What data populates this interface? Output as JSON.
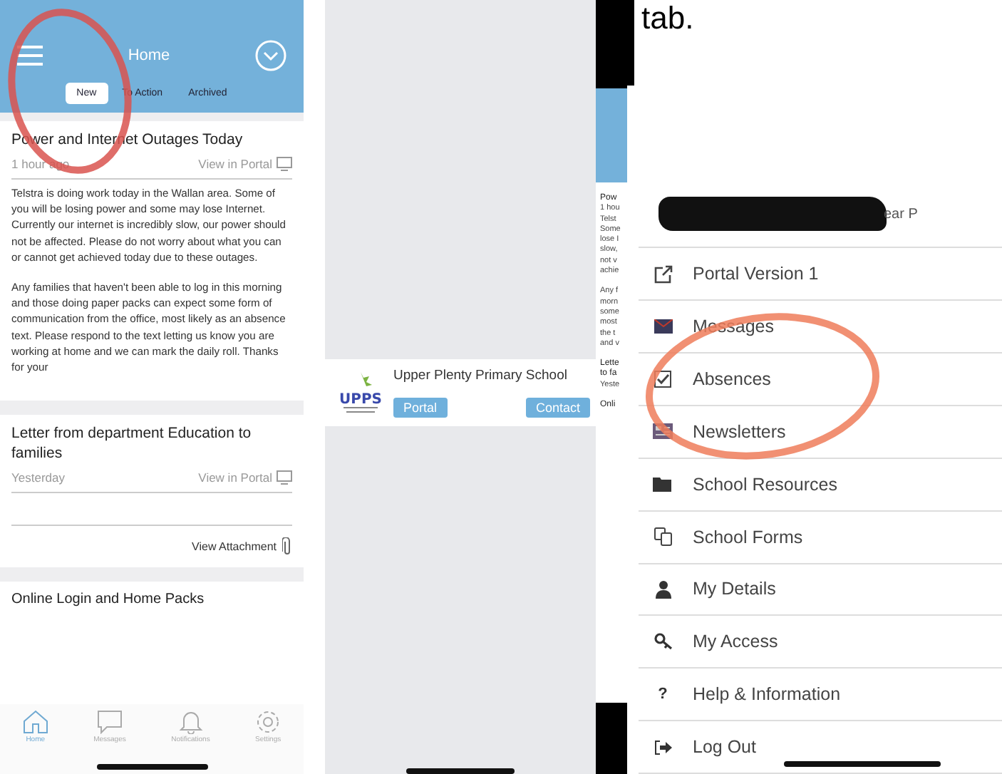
{
  "home_screen": {
    "title": "Home",
    "tabs": [
      {
        "label": "New",
        "selected": true
      },
      {
        "label": "To Action",
        "selected": false
      },
      {
        "label": "Archived",
        "selected": false
      }
    ],
    "posts": [
      {
        "title": "Power and Internet Outages Today",
        "time": "1 hour ago",
        "link": "View in Portal",
        "paragraphs": [
          "Telstra is doing work today in the Wallan area. Some of you will be losing power and some may lose Internet. Currently our internet is incredibly slow, our power should not be affected. Please do not worry about what you can or cannot get achieved today due to these outages.",
          "Any families that haven't been able to log in this morning and those doing paper packs can expect some form of communication from the office, most likely as an absence text. Please respond to the text letting us know you are working at home and we can mark the daily roll. Thanks for your"
        ]
      },
      {
        "title": "Letter from department Education to families",
        "time": "Yesterday",
        "link": "View in Portal",
        "attachment": "View Attachment"
      }
    ],
    "next_post_title": "Online Login and Home Packs",
    "nav": [
      {
        "label": "Home",
        "selected": true
      },
      {
        "label": "Messages",
        "selected": false
      },
      {
        "label": "Notifications",
        "selected": false
      },
      {
        "label": "Settings",
        "selected": false
      }
    ]
  },
  "school_screen": {
    "school": "Upper Plenty Primary School",
    "logo_text": "UPPS",
    "buttons": [
      "Portal",
      "Contact"
    ],
    "peek_lines": [
      "Pow",
      "1 hou",
      "Telst",
      "Some",
      "lose I",
      "slow,",
      "not v",
      "achie",
      "Any f",
      "morn",
      "some",
      "most",
      "the t",
      "and v",
      "Lette",
      "to fa",
      "Yeste",
      "Onli"
    ]
  },
  "menu_screen": {
    "caption": "tab.",
    "profile_text": "ear P",
    "help_glyph": "?",
    "items": [
      "Portal Version 1",
      "Messages",
      "Absences",
      "Newsletters",
      "School Resources",
      "School Forms",
      "My Details",
      "My Access",
      "Help & Information",
      "Log Out"
    ]
  }
}
